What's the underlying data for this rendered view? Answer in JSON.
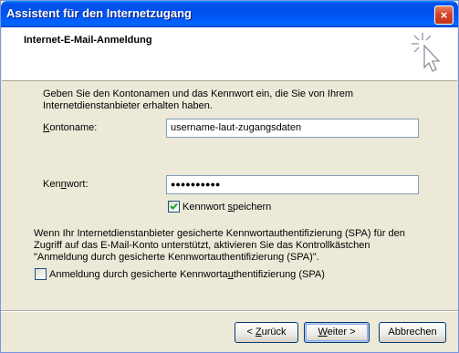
{
  "window": {
    "title": "Assistent für den Internetzugang",
    "close_glyph": "×"
  },
  "header": {
    "title": "Internet-E-Mail-Anmeldung",
    "icon": "wizard-sparkle-cursor-icon"
  },
  "intro": {
    "line1": "Geben Sie den Kontonamen und das Kennwort ein, die Sie von Ihrem",
    "line2": "Internetdienstanbieter erhalten haben."
  },
  "account": {
    "label_mnemonic": "K",
    "label_rest": "ontoname:",
    "value": "username-laut-zugangsdaten"
  },
  "password": {
    "label_pre": "Ken",
    "label_mnemonic": "n",
    "label_post": "wort:",
    "masked_value": "●●●●●●●●●●"
  },
  "remember": {
    "checked": true,
    "label_pre": "Kennwort ",
    "label_mnemonic": "s",
    "label_post": "peichern"
  },
  "spa_info": {
    "line1": "Wenn Ihr Internetdienstanbieter gesicherte Kennwortauthentifizierung (SPA) für den",
    "line2": "Zugriff auf das E-Mail-Konto unterstützt, aktivieren Sie das Kontrollkästchen",
    "line3": "\"Anmeldung durch gesicherte Kennwortauthentifizierung (SPA)\"."
  },
  "spa": {
    "checked": false,
    "label_pre": "Anmeldung durch gesicherte Kennworta",
    "label_mnemonic": "u",
    "label_post": "thentifizierung (SPA)"
  },
  "buttons": {
    "back_pre": "< ",
    "back_mnemonic": "Z",
    "back_post": "urück",
    "next_mnemonic": "W",
    "next_post": "eiter >",
    "cancel": "Abbrechen"
  },
  "colors": {
    "title_blue": "#0054e3",
    "face": "#ece9d8",
    "check_green": "#21a121"
  }
}
